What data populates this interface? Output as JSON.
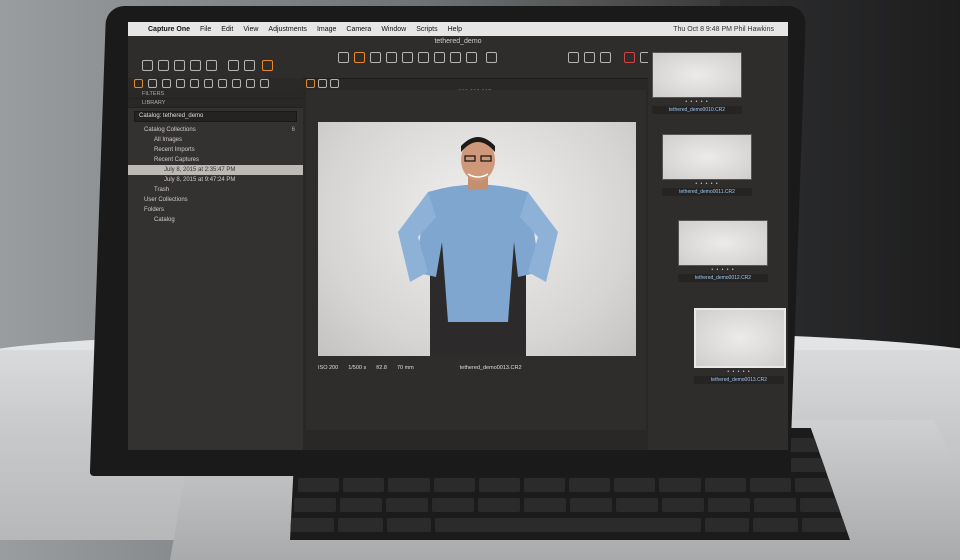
{
  "menubar": {
    "apple": "",
    "app_name": "Capture One",
    "items": [
      "File",
      "Edit",
      "View",
      "Adjustments",
      "Image",
      "Camera",
      "Window",
      "Scripts",
      "Help"
    ],
    "right": "Thu Oct 8  9:48 PM   Phil Hawkins"
  },
  "window": {
    "title": "tethered_demo"
  },
  "toolbar": {
    "r": "209",
    "g": "219",
    "b": "215"
  },
  "left_panel": {
    "filters_header": "FILTERS",
    "library_header": "LIBRARY",
    "catalog_label": "Catalog: tethered_demo",
    "catalog_collections": "Catalog Collections",
    "catalog_collections_count": "6",
    "all_images": "All Images",
    "recent_imports": "Recent Imports",
    "recent_captures": "Recent Captures",
    "capture_1": "July 8, 2015 at 2:35:47 PM",
    "capture_2": "July 8, 2015 at 9:47:24 PM",
    "trash": "Trash",
    "user_collections": "User Collections",
    "folders": "Folders",
    "catalog_folder": "Catalog"
  },
  "viewer": {
    "iso": "ISO 200",
    "shutter": "1/500 s",
    "aperture": "f/2.8",
    "focal": "70 mm",
    "filename": "tethered_demo0013.CR2"
  },
  "filmstrip": {
    "thumbs": [
      {
        "stars": "• • • • •",
        "name": "tethered_demo0010.CR2"
      },
      {
        "stars": "• • • • •",
        "name": "tethered_demo0011.CR2"
      },
      {
        "stars": "• • • • •",
        "name": "tethered_demo0012.CR2"
      },
      {
        "stars": "• • • • •",
        "name": "tethered_demo0013.CR2"
      }
    ]
  },
  "colors": {
    "accent_orange": "#e88a2c",
    "selection": "#bdbab6",
    "panel": "#343231"
  }
}
